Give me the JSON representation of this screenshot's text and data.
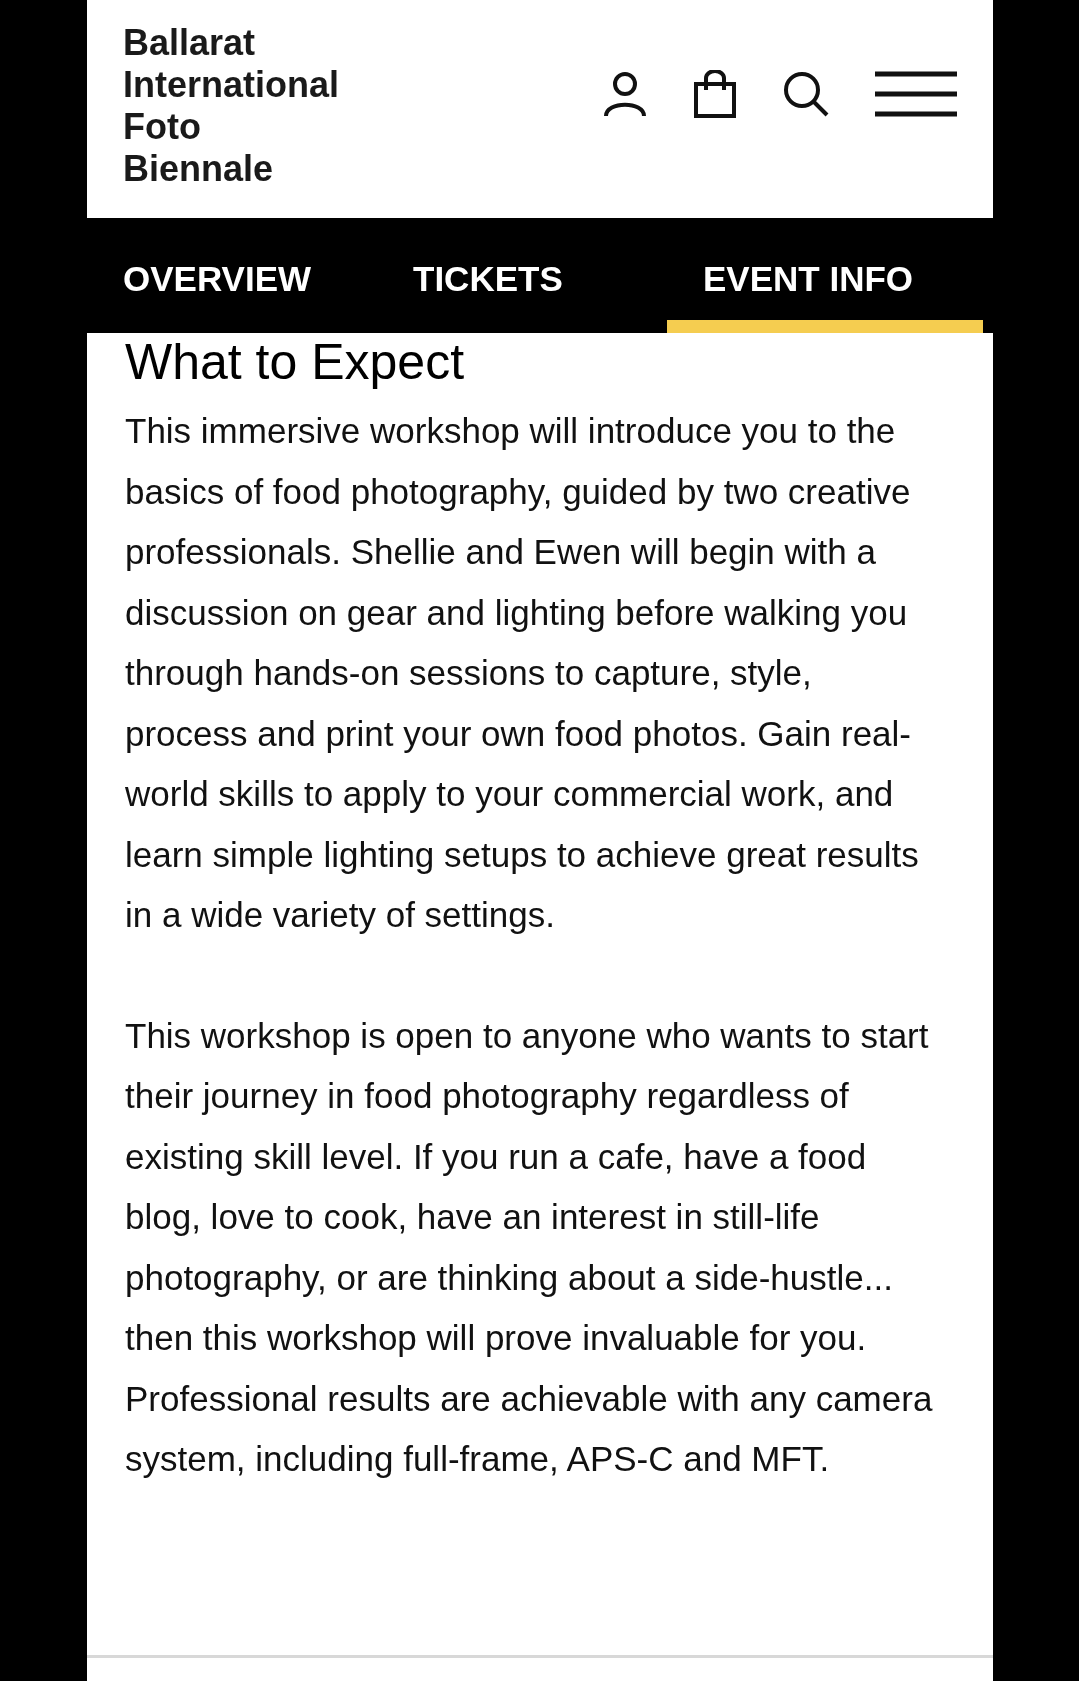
{
  "logo": [
    "Ballarat",
    "International",
    "Foto",
    "Biennale"
  ],
  "tabs": [
    {
      "label": "OVERVIEW",
      "selected": false
    },
    {
      "label": "TICKETS",
      "selected": false
    },
    {
      "label": "EVENT INFO",
      "selected": true
    }
  ],
  "section": {
    "heading": "What to Expect",
    "paragraphs": [
      "This immersive workshop will introduce you to the basics of food photography, guided by two creative professionals. Shellie and Ewen will begin with a discussion on gear and lighting before walking you through hands-on sessions to capture, style, process and print your own food photos. Gain real-world skills to apply to your commercial work, and learn simple lighting setups to achieve great results in a wide variety of settings.",
      "This workshop is open to anyone who wants to start their journey in food photography regardless of existing skill level. If you run a cafe, have a food blog, love to cook, have an interest in still-life photography, or are thinking about a side-hustle... then this workshop will prove invaluable for you. Professional results are achievable with any camera system, including full-frame, APS-C and MFT."
    ]
  }
}
